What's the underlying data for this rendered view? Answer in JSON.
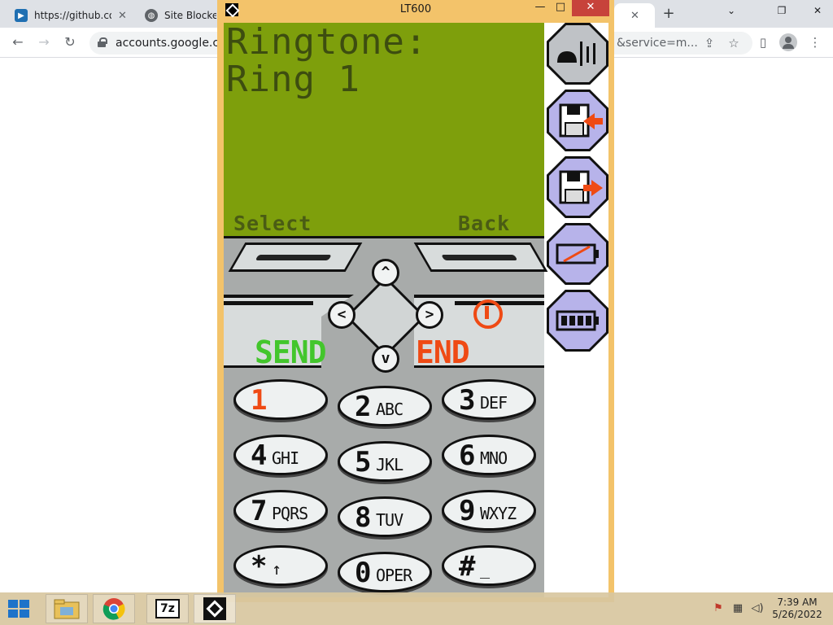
{
  "browser": {
    "tabs": [
      {
        "title": "https://github.com/",
        "favicon": "video-icon"
      },
      {
        "title": "Site Blocked",
        "favicon": "globe-icon"
      }
    ],
    "url_left": "accounts.google.com",
    "url_right": "&service=m..."
  },
  "emulator": {
    "title": "LT600",
    "window_buttons": {
      "minimize": "—",
      "maximize": "□",
      "close": "✕"
    },
    "screen": {
      "lines": [
        "Ringtone:",
        "Ring 1"
      ],
      "left_softkey": "Select",
      "right_softkey": "Back"
    },
    "call_keys": {
      "send": "SEND",
      "end": "END"
    },
    "keypad": [
      {
        "digit": "1",
        "letters": ""
      },
      {
        "digit": "2",
        "letters": "ABC"
      },
      {
        "digit": "3",
        "letters": "DEF"
      },
      {
        "digit": "4",
        "letters": "GHI"
      },
      {
        "digit": "5",
        "letters": "JKL"
      },
      {
        "digit": "6",
        "letters": "MNO"
      },
      {
        "digit": "7",
        "letters": "PQRS"
      },
      {
        "digit": "8",
        "letters": "TUV"
      },
      {
        "digit": "9",
        "letters": "WXYZ"
      },
      {
        "digit": "*",
        "letters": "↑"
      },
      {
        "digit": "0",
        "letters": "OPER"
      },
      {
        "digit": "#",
        "letters": "_"
      }
    ],
    "side_tools": [
      "signal-icon",
      "load-disk-icon",
      "save-disk-icon",
      "no-battery-icon",
      "battery-full-icon"
    ]
  },
  "taskbar": {
    "apps": [
      "file-explorer-icon",
      "chrome-icon",
      "7zip-icon",
      "emulator-icon"
    ],
    "app_7z_label": "7z",
    "time": "7:39 AM",
    "date": "5/26/2022"
  },
  "colors": {
    "lcd_bg": "#7e9f0c",
    "lcd_text": "#3d4d10",
    "send_green": "#43c62c",
    "end_red": "#ef4a14",
    "window_frame": "#f3c36a"
  }
}
